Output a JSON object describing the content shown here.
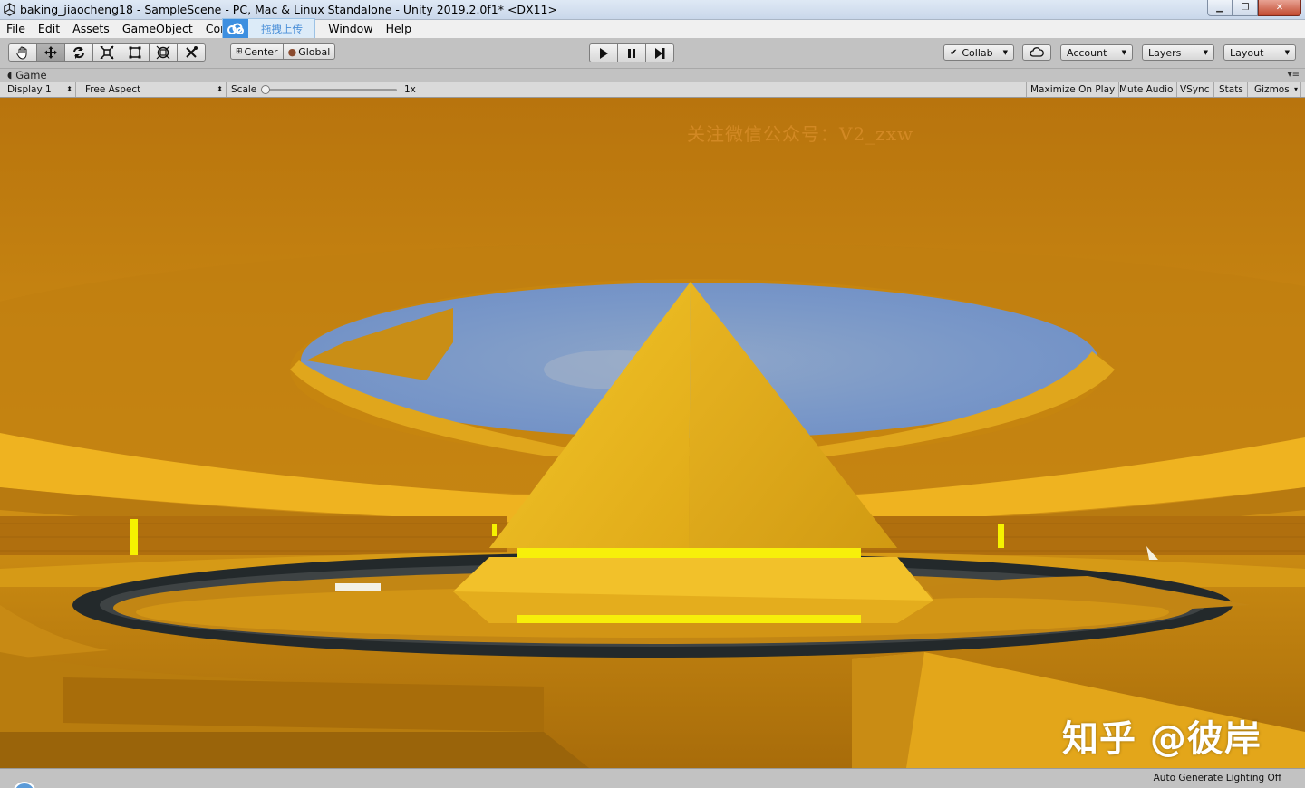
{
  "window": {
    "title": "baking_jiaocheng18 - SampleScene - PC, Mac & Linux Standalone - Unity 2019.2.0f1* <DX11>",
    "controls": [
      "minimize",
      "maximize",
      "close"
    ]
  },
  "menu": {
    "items": [
      "File",
      "Edit",
      "Assets",
      "GameObject",
      "Comp",
      "Window",
      "Help"
    ]
  },
  "upload_overlay": {
    "label": "拖拽上传",
    "icon": "cloud-icon",
    "color": "#3d8fe0"
  },
  "toolbar": {
    "transform_tools": [
      "hand-tool-icon",
      "move-tool-icon",
      "rotate-tool-icon",
      "scale-tool-icon",
      "rect-tool-icon",
      "transform-tool-icon",
      "custom-tool-icon"
    ],
    "pivot_label": "Center",
    "space_label": "Global",
    "play_controls": [
      "play-icon",
      "pause-icon",
      "step-icon"
    ],
    "collab_label": "Collab",
    "account_label": "Account",
    "layers_label": "Layers",
    "layout_label": "Layout"
  },
  "game_tab": {
    "label": "Game"
  },
  "game_bar": {
    "display": "Display 1",
    "aspect": "Free Aspect",
    "scale_label": "Scale",
    "scale_value": "1x",
    "maximize_on_play": "Maximize On Play",
    "mute_audio": "Mute Audio",
    "vsync": "VSync",
    "stats": "Stats",
    "gizmos": "Gizmos"
  },
  "viewport": {
    "watermark_top": "关注微信公众号：V2_zxw",
    "watermark_bottom": "知乎 @彼岸",
    "colors": {
      "gold": "#e8b21c",
      "sky": "#7f9ccc",
      "glow": "#f4f000",
      "dark": "#1e2426"
    }
  },
  "status": {
    "right_text": "Auto Generate Lighting Off"
  }
}
